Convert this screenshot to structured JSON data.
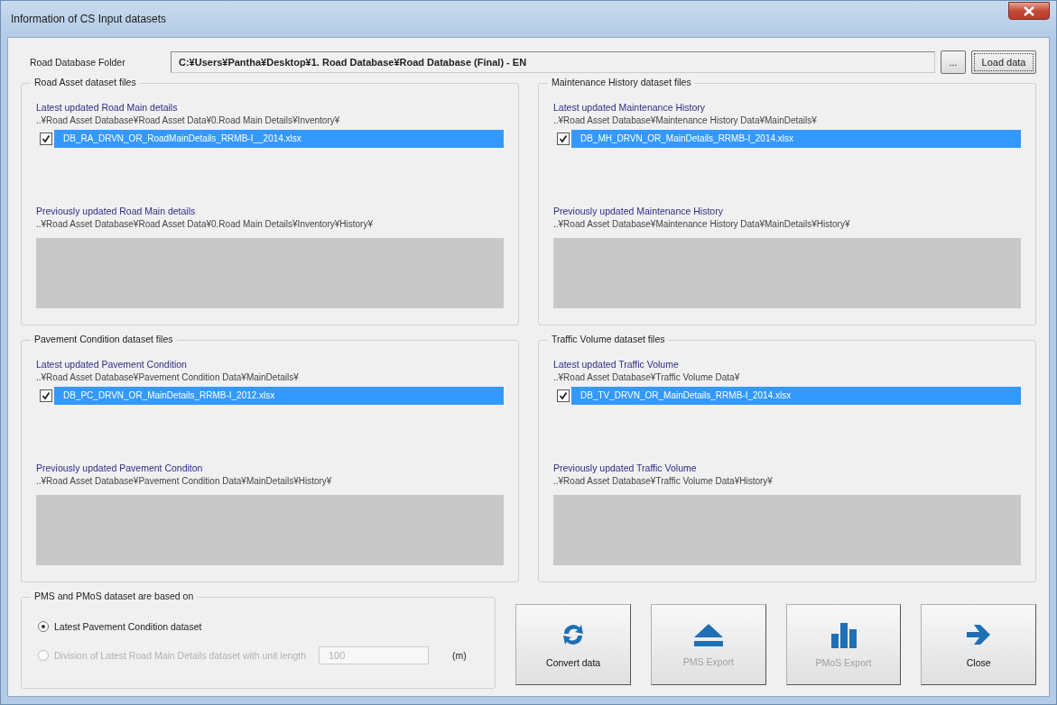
{
  "window": {
    "title": "Information of CS Input datasets"
  },
  "folder": {
    "label": "Road Database Folder",
    "value": "C:¥Users¥Pantha¥Desktop¥1. Road Database¥Road Database (Final) - EN",
    "browse_button": "...",
    "load_button": "Load data"
  },
  "groups": [
    {
      "title": "Road Asset dataset files",
      "latest": {
        "label": "Latest updated Road Main details",
        "path": "..¥Road Asset Database¥Road Asset Data¥0.Road Main Details¥Inventory¥",
        "files": [
          {
            "name": "DB_RA_DRVN_OR_RoadMainDetails_RRMB-I__2014.xlsx",
            "checked": true,
            "selected": true
          }
        ]
      },
      "previous": {
        "label": "Previously updated Road Main details",
        "path": "..¥Road Asset Database¥Road Asset Data¥0.Road Main Details¥Inventory¥History¥"
      }
    },
    {
      "title": "Maintenance History dataset files",
      "latest": {
        "label": "Latest updated Maintenance History",
        "path": "..¥Road Asset Database¥Maintenance History Data¥MainDetails¥",
        "files": [
          {
            "name": "DB_MH_DRVN_OR_MainDetails_RRMB-I_2014.xlsx",
            "checked": true,
            "selected": true
          }
        ]
      },
      "previous": {
        "label": "Previously updated Maintenance History",
        "path": "..¥Road Asset Database¥Maintenance History Data¥MainDetails¥History¥"
      }
    },
    {
      "title": "Pavement Condition dataset files",
      "latest": {
        "label": "Latest updated Pavement Condition",
        "path": "..¥Road Asset Database¥Pavement Condition Data¥MainDetails¥",
        "files": [
          {
            "name": "DB_PC_DRVN_OR_MainDetails_RRMB-I_2012.xlsx",
            "checked": true,
            "selected": true
          }
        ]
      },
      "previous": {
        "label": "Previously updated Pavement Conditon",
        "path": "..¥Road Asset Database¥Pavement Condition Data¥MainDetails¥History¥"
      }
    },
    {
      "title": "Traffic Volume dataset files",
      "latest": {
        "label": "Latest updated Traffic Volume",
        "path": "..¥Road Asset Database¥Traffic Volume Data¥",
        "files": [
          {
            "name": "DB_TV_DRVN_OR_MainDetails_RRMB-I_2014.xlsx",
            "checked": true,
            "selected": true
          }
        ]
      },
      "previous": {
        "label": "Previously updated Traffic Volume",
        "path": "..¥Road Asset Database¥Traffic Volume Data¥History¥"
      }
    }
  ],
  "options": {
    "title": "PMS and PMoS dataset are based on",
    "items": [
      {
        "label": "Latest Pavement Condition dataset",
        "selected": true,
        "disabled": false
      },
      {
        "label": "Division of Latest Road Main Details dataset with unit length",
        "selected": false,
        "disabled": true
      }
    ],
    "unit_length": {
      "value": "100",
      "unit": "(m)",
      "disabled": true
    }
  },
  "buttons": [
    {
      "label": "Convert data",
      "kind": "convert",
      "disabled": false
    },
    {
      "label": "PMS Export",
      "kind": "eject",
      "disabled": true
    },
    {
      "label": "PMoS Export",
      "kind": "chart",
      "disabled": true
    },
    {
      "label": "Close",
      "kind": "arrow",
      "disabled": false
    }
  ]
}
